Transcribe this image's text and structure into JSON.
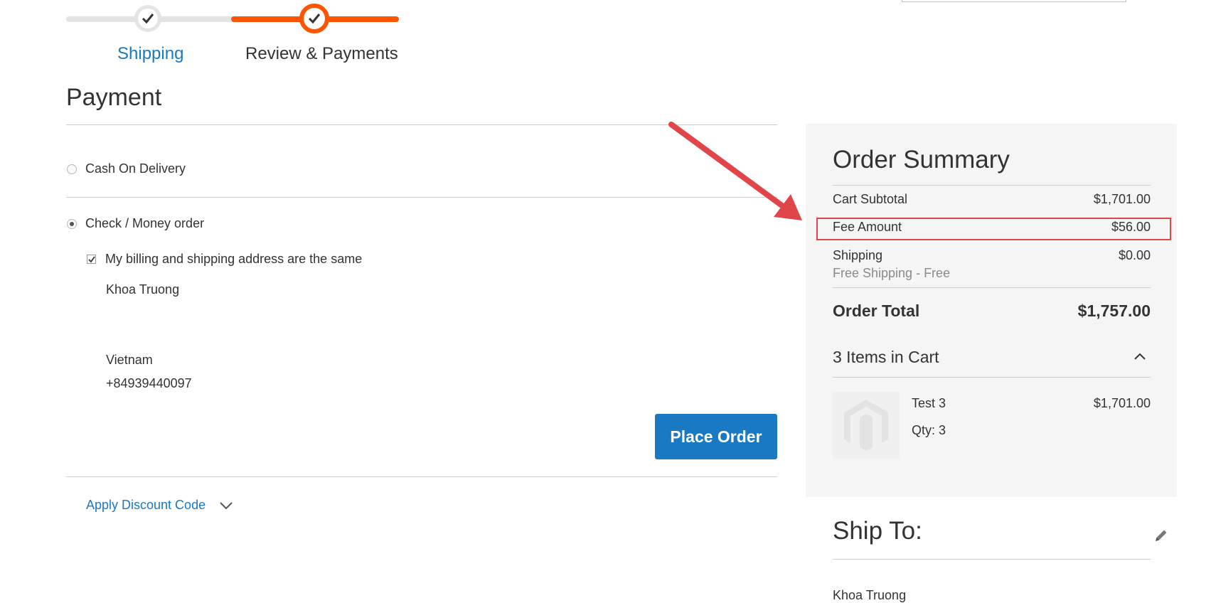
{
  "progress": {
    "steps": [
      {
        "label": "Shipping",
        "state": "complete"
      },
      {
        "label": "Review & Payments",
        "state": "active"
      }
    ],
    "colors": {
      "complete": "#e4e4e4",
      "active": "#ff5501",
      "link": "#1979c3"
    }
  },
  "payment": {
    "title": "Payment",
    "methods": [
      {
        "label": "Cash On Delivery",
        "selected": false
      },
      {
        "label": "Check / Money order",
        "selected": true
      }
    ],
    "same_address_label": "My billing and shipping address are the same",
    "same_address_checked": true,
    "address": {
      "name": "Khoa Truong",
      "country": "Vietnam",
      "phone": "+84939440097"
    },
    "place_order_label": "Place Order",
    "discount_label": "Apply Discount Code"
  },
  "summary": {
    "title": "Order Summary",
    "rows": {
      "subtotal": {
        "label": "Cart Subtotal",
        "value": "$1,701.00"
      },
      "fee": {
        "label": "Fee Amount",
        "value": "$56.00"
      },
      "shipping": {
        "label": "Shipping",
        "value": "$0.00",
        "method": "Free Shipping - Free"
      }
    },
    "total": {
      "label": "Order Total",
      "value": "$1,757.00"
    },
    "items_header": "3 Items in Cart",
    "items": [
      {
        "name": "Test 3",
        "qty": "Qty: 3",
        "price": "$1,701.00"
      }
    ],
    "highlight_color": "#e0454a"
  },
  "ship_to": {
    "title": "Ship To:",
    "name": "Khoa Truong"
  },
  "icons": [
    "check-icon",
    "chevron-down-icon",
    "chevron-up-icon",
    "pencil-icon",
    "magento-logo-icon",
    "arrow-annotation-icon"
  ]
}
